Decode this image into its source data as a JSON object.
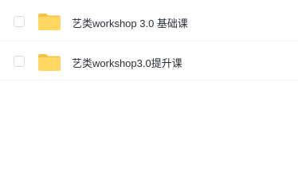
{
  "files": [
    {
      "name": "艺类workshop 3.0 基础课",
      "type": "folder",
      "icon": "folder-icon",
      "checked": false
    },
    {
      "name": "艺类workshop3.0提升课",
      "type": "folder",
      "icon": "folder-icon",
      "checked": false
    }
  ],
  "colors": {
    "folder_body": "#ffd760",
    "folder_tab": "#f5c242",
    "text": "#2b2f36",
    "divider": "#f1f2f4",
    "checkbox_border": "#d6d9de"
  }
}
